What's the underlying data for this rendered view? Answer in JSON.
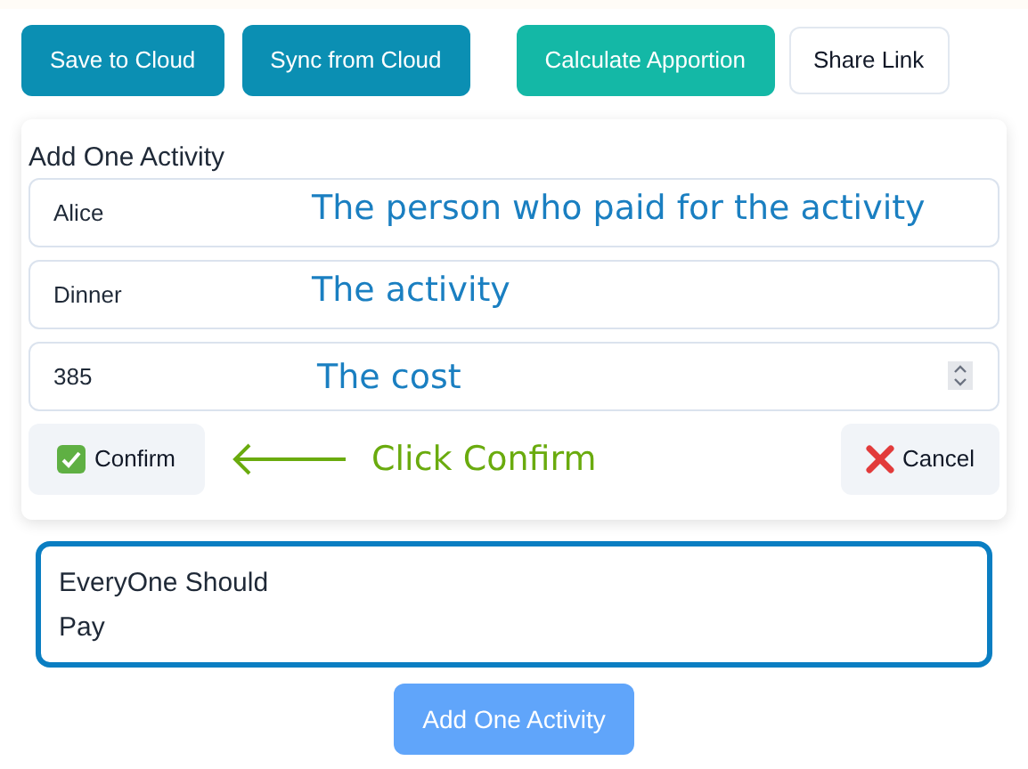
{
  "toolbar": [
    {
      "label": "Save to Cloud",
      "kind": "primary"
    },
    {
      "label": "Sync from Cloud",
      "kind": "primary"
    },
    {
      "label": "Calculate Apportion",
      "kind": "accent"
    },
    {
      "label": "Share Link",
      "kind": "outline"
    }
  ],
  "form": {
    "title": "Add One Activity",
    "fields": [
      {
        "kind": "text",
        "value": "Alice",
        "annotation": "The person who paid for the activity"
      },
      {
        "kind": "text",
        "value": "Dinner",
        "annotation": "The activity"
      },
      {
        "kind": "number",
        "value": "385",
        "annotation": "The cost"
      }
    ],
    "confirm": "Confirm",
    "hint": "Click Confirm",
    "cancel": "Cancel"
  },
  "result": {
    "lines": [
      "EveryOne Should",
      "Pay"
    ]
  },
  "add_button": "Add One Activity"
}
